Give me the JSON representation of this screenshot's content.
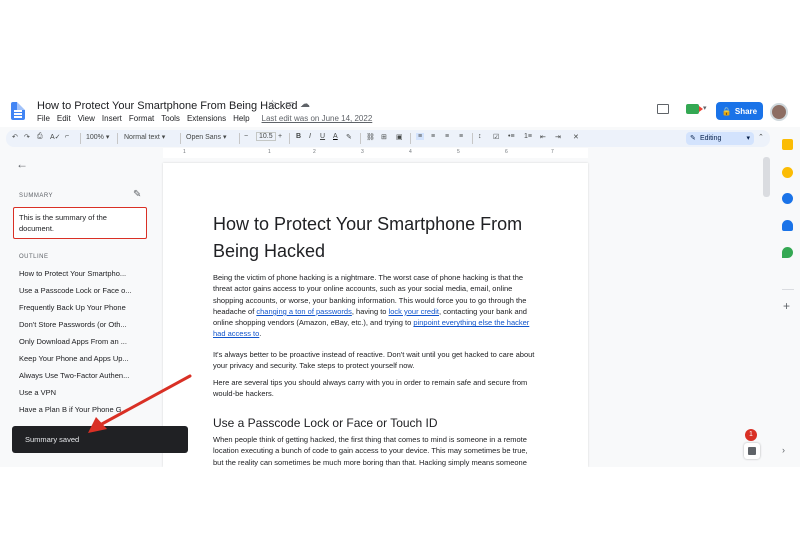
{
  "header": {
    "title": "How to Protect Your Smartphone From Being Hacked",
    "menus": [
      "File",
      "Edit",
      "View",
      "Insert",
      "Format",
      "Tools",
      "Extensions",
      "Help"
    ],
    "last_edit": "Last edit was on June 14, 2022",
    "share_label": "Share"
  },
  "toolbar": {
    "zoom": "100%",
    "style": "Normal text",
    "font": "Open Sans",
    "font_size": "10.5",
    "mode": "Editing"
  },
  "ruler": {
    "ticks": [
      "1",
      "1",
      "2",
      "3",
      "4",
      "5",
      "6",
      "7"
    ]
  },
  "sidebar": {
    "summary_label": "SUMMARY",
    "summary_text": "This is the summary of the document.",
    "outline_label": "OUTLINE",
    "outline": [
      "How to Protect Your Smartpho...",
      "Use a Passcode Lock or Face o...",
      "Frequently Back Up Your Phone",
      "Don't Store Passwords (or Oth...",
      "Only Download Apps From an ...",
      "Keep Your Phone and Apps Up...",
      "Always Use Two-Factor Authen...",
      "Use a VPN",
      "Have a Plan B if Your Phone G..."
    ]
  },
  "document": {
    "heading": "How to Protect Your Smartphone From Being Hacked",
    "p1_a": "Being the victim of phone hacking is a nightmare. The worst case of phone hacking is that the threat actor gains access to your online accounts, such as your social media, email, online shopping accounts, or worse, your banking information. This would force you to go through the headache of ",
    "p1_link1": "changing a ton of passwords",
    "p1_b": ", having to ",
    "p1_link2": "lock your credit",
    "p1_c": ", contacting your bank and online shopping vendors (Amazon, eBay, etc.), and trying to ",
    "p1_link3": "pinpoint everything else the hacker had access to",
    "p1_d": ".",
    "p2": "It's always better to be proactive instead of reactive. Don't wait until you get hacked to care about your privacy and security. Take steps to protect yourself now.",
    "p3": "Here are several tips you should always carry with you in order to remain safe and secure from would-be hackers.",
    "h2": "Use a Passcode Lock or Face or Touch ID",
    "p4": "When people think of getting hacked, the first thing that comes to mind is someone in a remote location executing a bunch of code to gain access to your device. This may sometimes be true, but the reality can sometimes be much more boring than that. Hacking simply means someone"
  },
  "toast": {
    "message": "Summary saved"
  },
  "badge": {
    "count": "1"
  },
  "colors": {
    "accent": "#1a73e8",
    "annotation": "#d93025",
    "toast_bg": "#202124"
  }
}
